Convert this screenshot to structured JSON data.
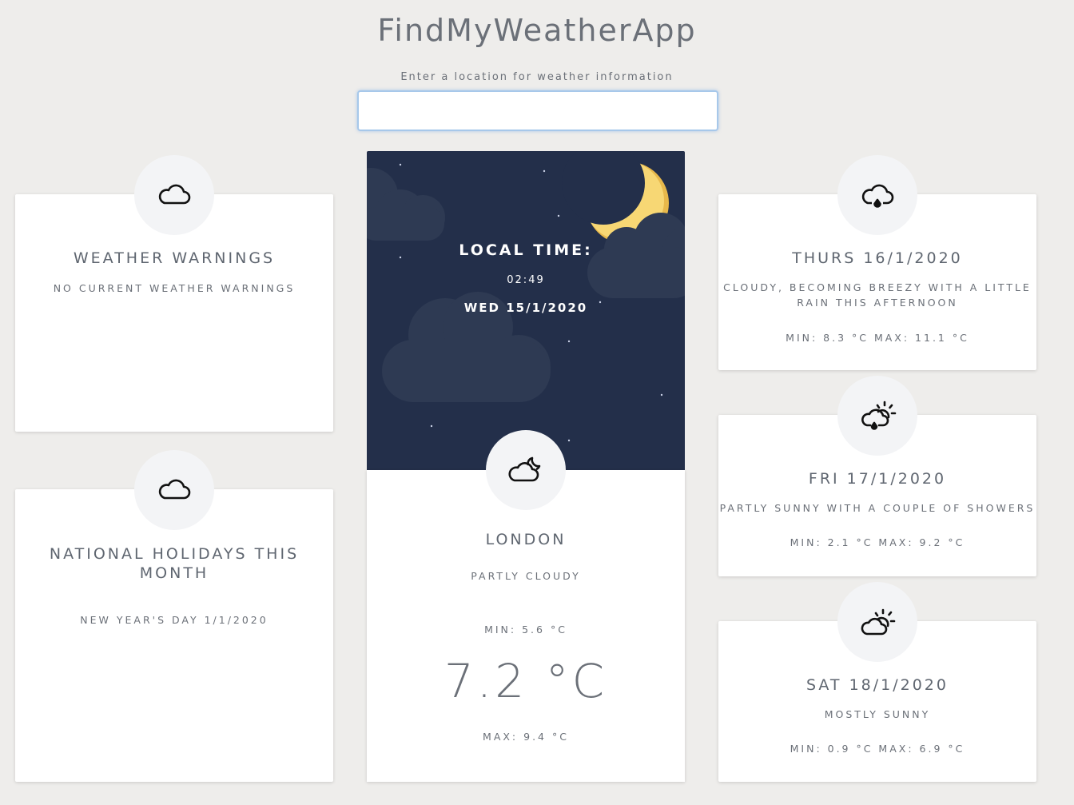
{
  "header": {
    "title": "FindMyWeatherApp",
    "search_label": "Enter a location for weather information",
    "search_value": ""
  },
  "warnings": {
    "icon": "cloud-icon",
    "title": "WEATHER WARNINGS",
    "text": "NO CURRENT WEATHER WARNINGS"
  },
  "holidays": {
    "icon": "cloud-icon",
    "title": "NATIONAL HOLIDAYS THIS MONTH",
    "text": "NEW YEAR'S DAY 1/1/2020"
  },
  "current": {
    "local_time_label": "LOCAL TIME:",
    "time": "02:49",
    "date": "WED 15/1/2020",
    "icon": "partly-cloudy-night-icon",
    "city": "LONDON",
    "condition": "PARTLY CLOUDY",
    "min": "MIN: 5.6 °C",
    "temp": "7.2 °C",
    "max": "MAX: 9.4 °C"
  },
  "forecast": [
    {
      "icon": "rain-cloud-icon",
      "date": "THURS 16/1/2020",
      "summary": "CLOUDY, BECOMING BREEZY WITH A LITTLE RAIN THIS AFTERNOON",
      "minmax": "MIN: 8.3 °C MAX: 11.1 °C"
    },
    {
      "icon": "sun-showers-icon",
      "date": "FRI 17/1/2020",
      "summary": "PARTLY SUNNY WITH A COUPLE OF SHOWERS",
      "minmax": "MIN: 2.1 °C MAX: 9.2 °C"
    },
    {
      "icon": "partly-sunny-icon",
      "date": "SAT 18/1/2020",
      "summary": "MOSTLY SUNNY",
      "minmax": "MIN: 0.9 °C MAX: 6.9 °C"
    }
  ],
  "colors": {
    "background": "#eeedeb",
    "night_sky": "#232f4a",
    "moon": "#f7d774",
    "input_focus": "#a7c8ea"
  }
}
